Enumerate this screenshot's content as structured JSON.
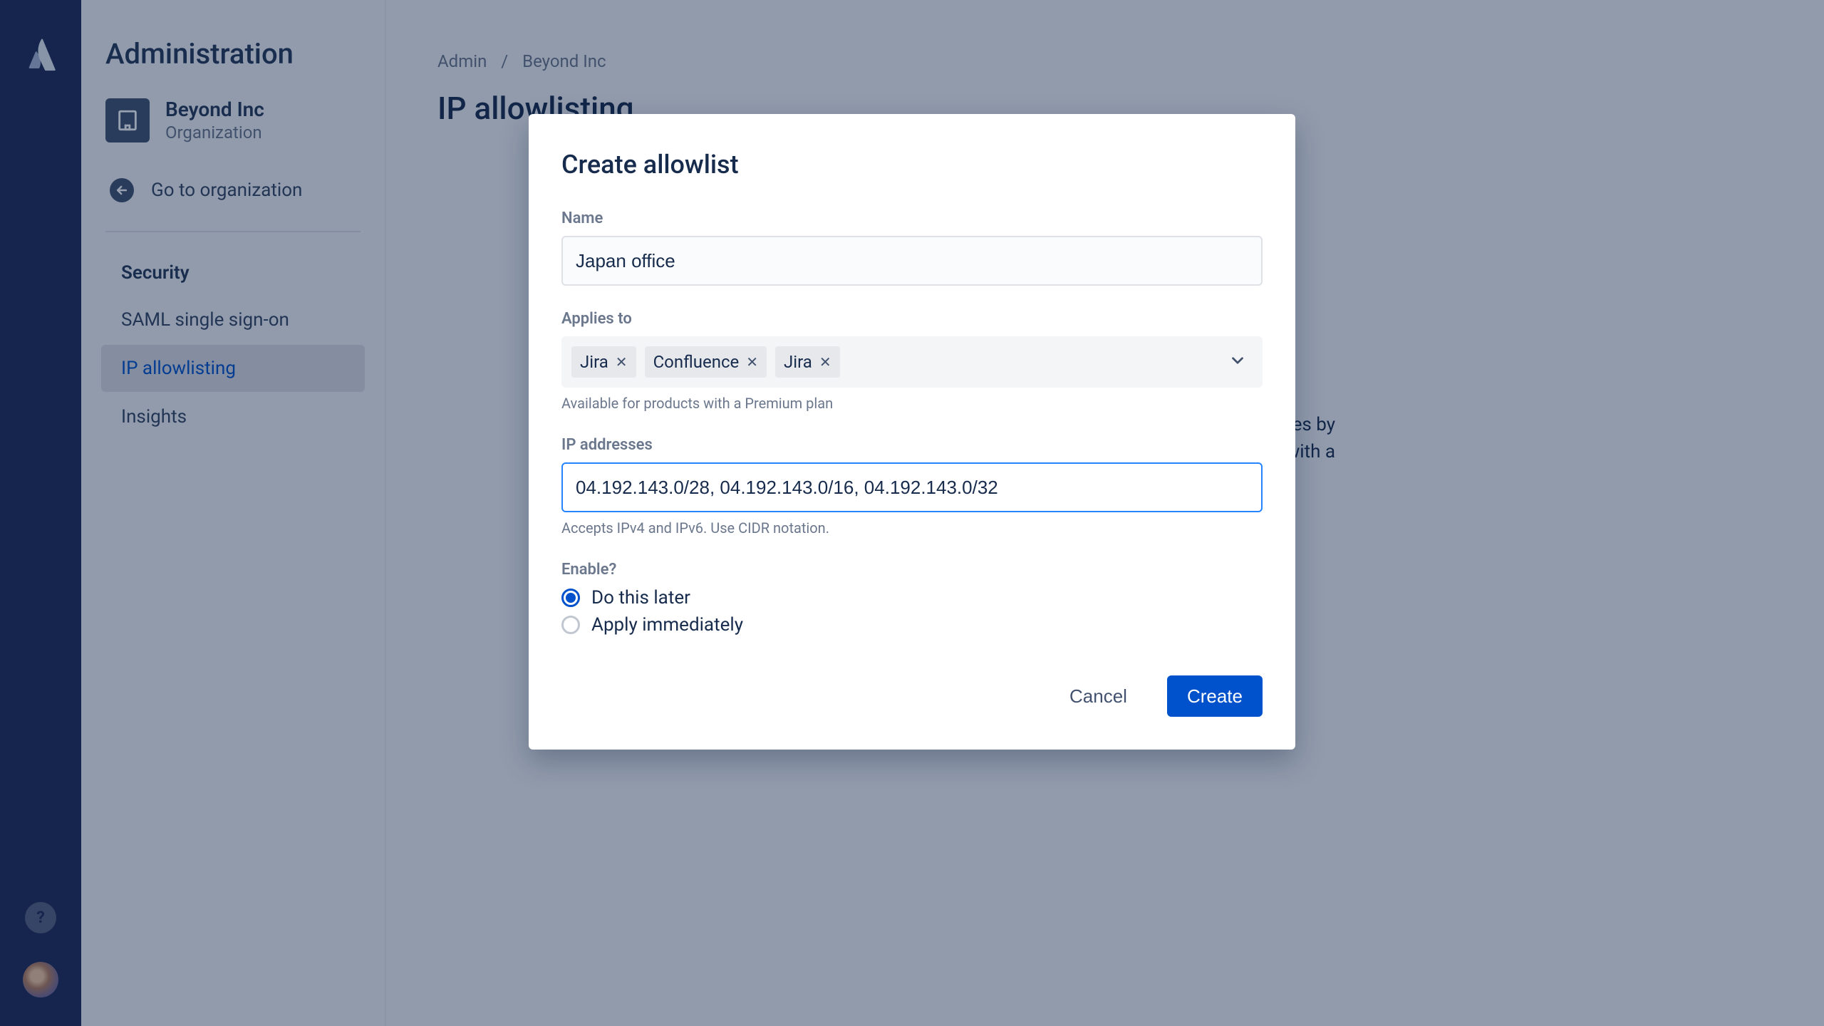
{
  "sidebar": {
    "title": "Administration",
    "org": {
      "name": "Beyond Inc",
      "subtitle": "Organization"
    },
    "goto": "Go to organization",
    "section_heading": "Security",
    "items": [
      {
        "label": "SAML single sign-on",
        "active": false
      },
      {
        "label": "IP allowlisting",
        "active": true
      },
      {
        "label": "Insights",
        "active": false
      }
    ]
  },
  "breadcrumb": {
    "root": "Admin",
    "current": "Beyond Inc"
  },
  "page": {
    "title": "IP allowlisting",
    "bg_line1": "…sses by",
    "bg_line2": "s with a"
  },
  "modal": {
    "title": "Create allowlist",
    "name_label": "Name",
    "name_value": "Japan office",
    "applies_label": "Applies to",
    "applies_hint": "Available for products with a Premium plan",
    "applies_tags": [
      "Jira",
      "Confluence",
      "Jira"
    ],
    "ip_label": "IP addresses",
    "ip_value": "04.192.143.0/28, 04.192.143.0/16, 04.192.143.0/32",
    "ip_hint": "Accepts IPv4 and IPv6. Use CIDR notation.",
    "enable_label": "Enable?",
    "enable_options": [
      {
        "label": "Do this later",
        "checked": true
      },
      {
        "label": "Apply immediately",
        "checked": false
      }
    ],
    "cancel": "Cancel",
    "create": "Create"
  }
}
